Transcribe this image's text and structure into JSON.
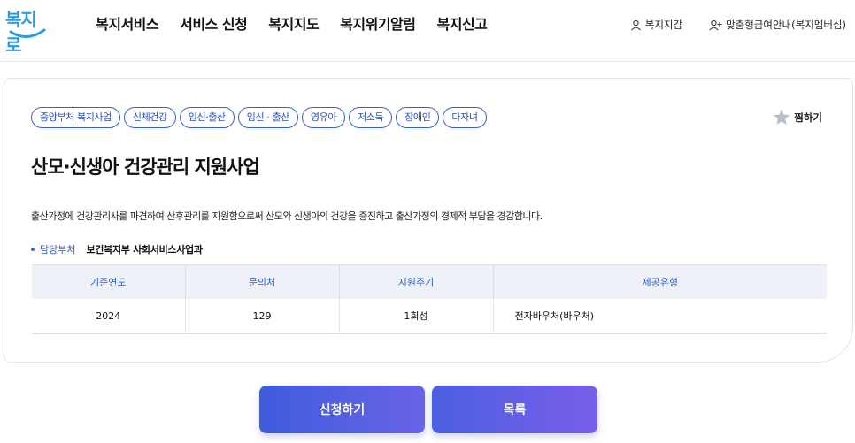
{
  "header": {
    "logo_text": "복지로",
    "nav": [
      "복지서비스",
      "서비스 신청",
      "복지지도",
      "복지위기알림",
      "복지신고"
    ],
    "util": {
      "wallet_label": "복지지갑",
      "membership_label": "맞춤형급여안내(복지멤버십)"
    }
  },
  "service": {
    "tags": [
      "중앙부처 복지사업",
      "신체건강",
      "임신·출산",
      "임신 · 출산",
      "영유아",
      "저소득",
      "장애인",
      "다자녀"
    ],
    "bookmark_label": "찜하기",
    "title": "산모·신생아 건강관리 지원사업",
    "description": "출산가정에 건강관리사를 파견하여 산후관리를 지원함으로써 산모와 신생아의 건강을 증진하고 출산가정의 경제적 부담을 경감합니다.",
    "dept_label": "담당부처",
    "dept_value": "보건복지부 사회서비스사업과",
    "table": {
      "headers": [
        "기준연도",
        "문의처",
        "지원주기",
        "제공유형"
      ],
      "row": [
        "2024",
        "129",
        "1회성",
        "전자바우처(바우처)"
      ]
    }
  },
  "actions": {
    "apply_label": "신청하기",
    "list_label": "목록"
  },
  "colors": {
    "accent": "#2a5cd8",
    "tag_border": "#3b5fd0",
    "button_gradient_start": "#3e5cdc",
    "button_gradient_end": "#7a5fe8",
    "logo": "#2c9be0"
  },
  "icons": [
    "user-icon",
    "user-plus-icon",
    "star-icon",
    "bullet-dot-icon"
  ]
}
